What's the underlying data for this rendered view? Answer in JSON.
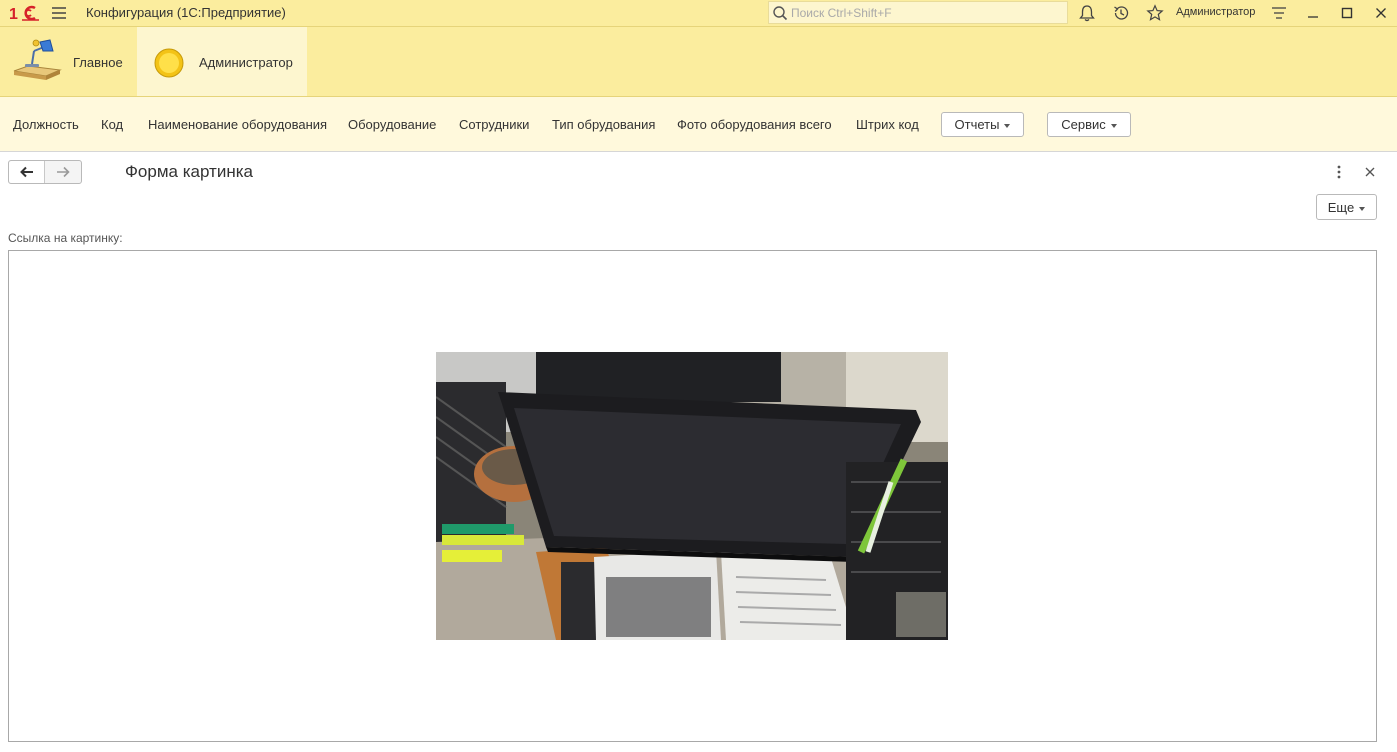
{
  "titlebar": {
    "app_title": "Конфигурация  (1С:Предприятие)",
    "search_placeholder": "Поиск Ctrl+Shift+F",
    "user_name": "Администратор",
    "icons": [
      "logo-1c-icon",
      "menu-icon",
      "search-icon",
      "bell-icon",
      "history-icon",
      "star-icon",
      "settings-lines-icon",
      "minimize-icon",
      "maximize-icon",
      "close-icon"
    ]
  },
  "sections": [
    {
      "label": "Главное",
      "icon": "desk-lamp-icon"
    },
    {
      "label": "Администратор",
      "icon": "sun-icon",
      "active": true
    }
  ],
  "commands": {
    "links": [
      "Должность",
      "Код",
      "Наименование оборудования",
      "Оборудование",
      "Сотрудники",
      "Тип обрудования",
      "Фото оборудования всего",
      "Штрих код"
    ],
    "reports_label": "Отчеты",
    "service_label": "Сервис"
  },
  "form": {
    "title": "Форма картинка",
    "more_label": "Еще",
    "field_label": "Ссылка на картинку:"
  },
  "colors": {
    "panel_yellow": "#fbed9e",
    "panel_light": "#fff9dc",
    "active_section": "#fdf6cf",
    "accent_red": "#d6222a"
  }
}
